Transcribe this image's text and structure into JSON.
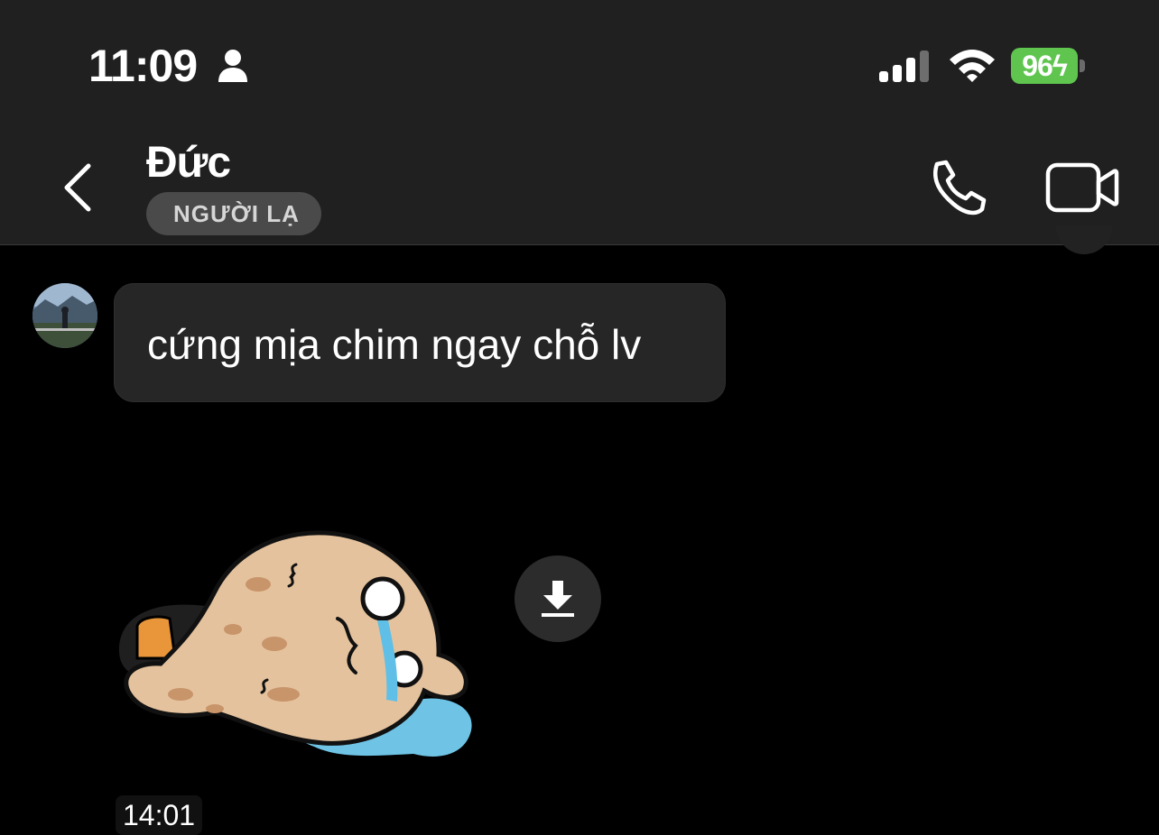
{
  "status_bar": {
    "time": "11:09",
    "battery": "96",
    "icons": [
      "person-icon",
      "signal-icon",
      "wifi-icon",
      "battery-icon"
    ]
  },
  "header": {
    "contact_name": "Đức",
    "badge": "NGƯỜI LẠ",
    "icons": [
      "chevron-left-icon",
      "phone-icon",
      "video-camera-icon"
    ]
  },
  "messages": [
    {
      "type": "text",
      "text": "cứng mịa chim ngay chỗ lv"
    },
    {
      "type": "sticker",
      "icon": "crying-peanut-sticker",
      "time": "14:01"
    }
  ],
  "colors": {
    "header_bg": "#202020",
    "chat_bg": "#000000",
    "bubble_bg": "#262626",
    "battery_green": "#5fc54f",
    "badge_bg": "#4a4a4a"
  }
}
